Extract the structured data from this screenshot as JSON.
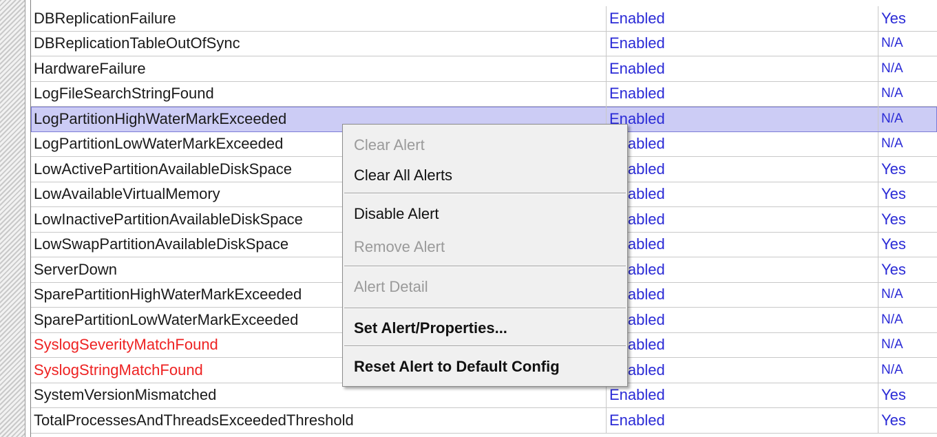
{
  "alerts": [
    {
      "name": "DBReplicationFailure",
      "status": "Enabled",
      "safe": "Yes"
    },
    {
      "name": "DBReplicationTableOutOfSync",
      "status": "Enabled",
      "safe": "N/A"
    },
    {
      "name": "HardwareFailure",
      "status": "Enabled",
      "safe": "N/A"
    },
    {
      "name": "LogFileSearchStringFound",
      "status": "Enabled",
      "safe": "N/A"
    },
    {
      "name": "LogPartitionHighWaterMarkExceeded",
      "status": "Enabled",
      "safe": "N/A"
    },
    {
      "name": "LogPartitionLowWaterMarkExceeded",
      "status": "Enabled",
      "safe": "N/A"
    },
    {
      "name": "LowActivePartitionAvailableDiskSpace",
      "status": "Enabled",
      "safe": "Yes"
    },
    {
      "name": "LowAvailableVirtualMemory",
      "status": "Enabled",
      "safe": "Yes"
    },
    {
      "name": "LowInactivePartitionAvailableDiskSpace",
      "status": "Enabled",
      "safe": "Yes"
    },
    {
      "name": "LowSwapPartitionAvailableDiskSpace",
      "status": "Enabled",
      "safe": "Yes"
    },
    {
      "name": "ServerDown",
      "status": "Enabled",
      "safe": "Yes"
    },
    {
      "name": "SparePartitionHighWaterMarkExceeded",
      "status": "Enabled",
      "safe": "N/A"
    },
    {
      "name": "SparePartitionLowWaterMarkExceeded",
      "status": "Enabled",
      "safe": "N/A"
    },
    {
      "name": "SyslogSeverityMatchFound",
      "status": "Enabled",
      "safe": "N/A"
    },
    {
      "name": "SyslogStringMatchFound",
      "status": "Enabled",
      "safe": "N/A"
    },
    {
      "name": "SystemVersionMismatched",
      "status": "Enabled",
      "safe": "Yes"
    },
    {
      "name": "TotalProcessesAndThreadsExceededThreshold",
      "status": "Enabled",
      "safe": "Yes"
    }
  ],
  "context_menu": {
    "clear_alert": "Clear Alert",
    "clear_all_alerts": "Clear All Alerts",
    "disable_alert": "Disable Alert",
    "remove_alert": "Remove Alert",
    "alert_detail": "Alert Detail",
    "set_alert_properties": "Set Alert/Properties...",
    "reset_alert_default": "Reset Alert to Default Config"
  },
  "colors": {
    "status_text": "#2a2ad6",
    "highlight_name_text": "#ee2222",
    "selected_row": "#ccccf5",
    "disabled_menu_text": "#9a9a9a"
  }
}
